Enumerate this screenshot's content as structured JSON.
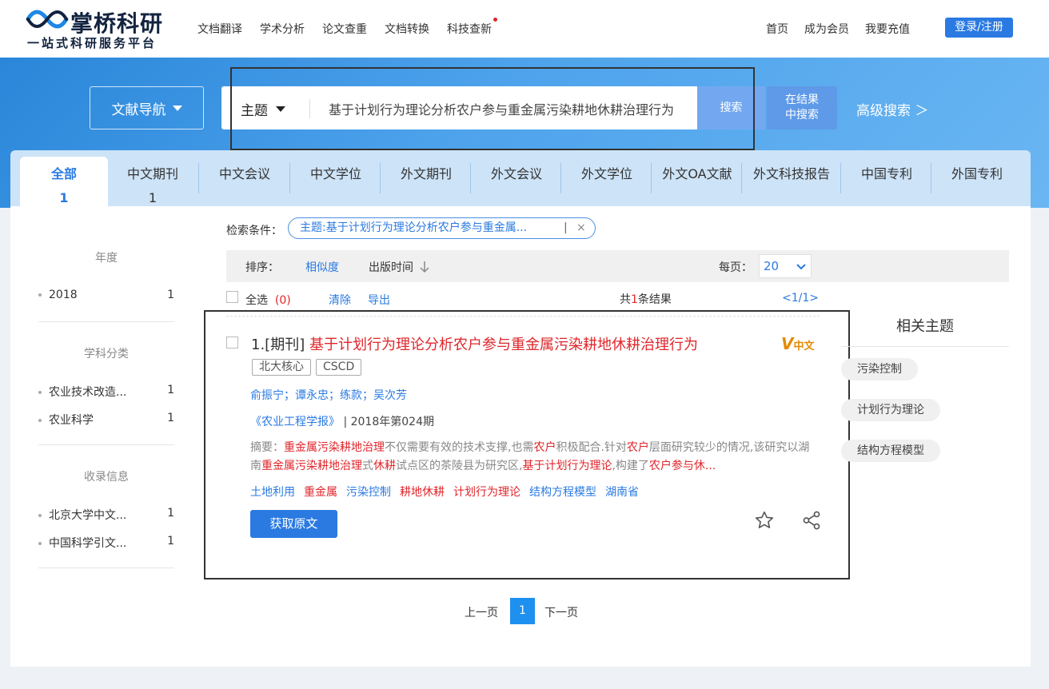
{
  "header": {
    "logo_text": "掌桥科研",
    "slogan": "一站式科研服务平台",
    "nav": [
      "文档翻译",
      "学术分析",
      "论文查重",
      "文档转换",
      "科技查新"
    ],
    "right_nav": [
      "首页",
      "成为会员",
      "我要充值"
    ],
    "login": "登录/注册"
  },
  "search": {
    "nav_button": "文献导航",
    "field": "主题",
    "query": "基于计划行为理论分析农户参与重金属污染耕地休耕治理行为",
    "search_button": "搜索",
    "in_results_line1": "在结果",
    "in_results_line2": "中搜索",
    "advanced": "高级搜索 ＞"
  },
  "tabs": [
    {
      "label": "全部",
      "count": "1"
    },
    {
      "label": "中文期刊",
      "count": "1"
    },
    {
      "label": "中文会议",
      "count": ""
    },
    {
      "label": "中文学位",
      "count": ""
    },
    {
      "label": "外文期刊",
      "count": ""
    },
    {
      "label": "外文会议",
      "count": ""
    },
    {
      "label": "外文学位",
      "count": ""
    },
    {
      "label": "外文OA文献",
      "count": ""
    },
    {
      "label": "外文科技报告",
      "count": ""
    },
    {
      "label": "中国专利",
      "count": ""
    },
    {
      "label": "外国专利",
      "count": ""
    }
  ],
  "sidebar": {
    "year": {
      "title": "年度",
      "items": [
        {
          "label": "2018",
          "count": "1"
        }
      ]
    },
    "subject": {
      "title": "学科分类",
      "items": [
        {
          "label": "农业技术改造...",
          "count": "1"
        },
        {
          "label": "农业科学",
          "count": "1"
        }
      ]
    },
    "index": {
      "title": "收录信息",
      "items": [
        {
          "label": "北京大学中文...",
          "count": "1"
        },
        {
          "label": "中国科学引文...",
          "count": "1"
        }
      ]
    }
  },
  "conditions": {
    "label": "检索条件：",
    "tag": "主题:基于计划行为理论分析农户参与重金属...",
    "bar": "|",
    "close": "×"
  },
  "sort": {
    "label": "排序：",
    "similarity": "相似度",
    "pub_time": "出版时间",
    "per_page_label": "每页：",
    "per_page": "20"
  },
  "selection": {
    "select_all": "全选",
    "selected_count": "(0)",
    "clear": "清除",
    "export": "导出",
    "total_prefix": "共",
    "total_count": "1",
    "total_suffix": "条结果",
    "page": "<1/1>"
  },
  "result": {
    "index": "1.[期刊]",
    "title": "基于计划行为理论分析农户参与重金属污染耕地休耕治理行为",
    "badge_v": "V",
    "badge_lang": "中文",
    "tags": [
      "北大核心",
      "CSCD"
    ],
    "authors": "俞振宁；谭永忠；练款；吴次芳",
    "journal": "《农业工程学报》",
    "issue": "| 2018年第024期",
    "abstract_label": "摘要：",
    "abstract_parts": [
      {
        "t": "重金属污染耕地治理",
        "r": true
      },
      {
        "t": "不仅需要有效的技术支撑,也需",
        "r": false
      },
      {
        "t": "农户",
        "r": true
      },
      {
        "t": "积极配合.针对",
        "r": false
      },
      {
        "t": "农户",
        "r": true
      },
      {
        "t": "层面研究较少的情况,该研究以湖南",
        "r": false
      },
      {
        "t": "重金属污染耕地治理",
        "r": true
      },
      {
        "t": "式",
        "r": false
      },
      {
        "t": "休耕",
        "r": true
      },
      {
        "t": "试点区的茶陵县为研究区,",
        "r": false
      },
      {
        "t": "基于计划行为理论",
        "r": true
      },
      {
        "t": ",构建了",
        "r": false
      },
      {
        "t": "农户参与休...",
        "r": true
      }
    ],
    "keywords": [
      {
        "t": "土地利用",
        "r": false
      },
      {
        "t": "重金属",
        "r": true
      },
      {
        "t": "污染控制",
        "r": false
      },
      {
        "t": "耕地休耕",
        "r": true
      },
      {
        "t": "计划行为理论",
        "r": true
      },
      {
        "t": "结构方程模型",
        "r": false
      },
      {
        "t": "湖南省",
        "r": false
      }
    ],
    "get_button": "获取原文"
  },
  "related": {
    "title": "相关主题",
    "items": [
      "污染控制",
      "计划行为理论",
      "结构方程模型"
    ]
  },
  "pagination": {
    "prev": "上一页",
    "current": "1",
    "next": "下一页"
  },
  "colors": {
    "accent": "#2a7ae2",
    "highlight": "#e0262b",
    "banner": "#4ea3ec"
  }
}
